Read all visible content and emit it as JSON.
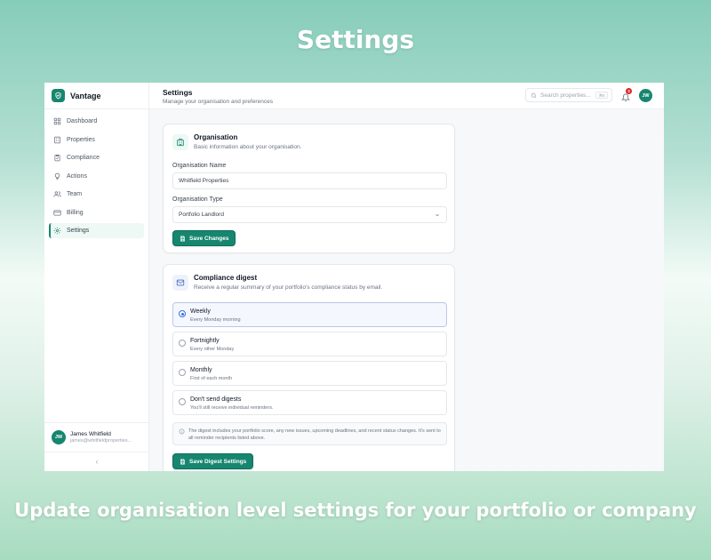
{
  "hero": {
    "title": "Settings",
    "caption": "Update organisation level settings for your portfolio or company"
  },
  "brand": {
    "name": "Vantage",
    "accent": "#16866f"
  },
  "sidebar": {
    "items": [
      {
        "label": "Dashboard",
        "icon": "grid-icon",
        "active": false
      },
      {
        "label": "Properties",
        "icon": "building-icon",
        "active": false
      },
      {
        "label": "Compliance",
        "icon": "clipboard-check-icon",
        "active": false
      },
      {
        "label": "Actions",
        "icon": "lightbulb-icon",
        "active": false
      },
      {
        "label": "Team",
        "icon": "users-icon",
        "active": false
      },
      {
        "label": "Billing",
        "icon": "credit-card-icon",
        "active": false
      },
      {
        "label": "Settings",
        "icon": "gear-icon",
        "active": true
      }
    ],
    "user": {
      "initials": "JW",
      "name": "James Whitfield",
      "email": "james@whitfieldproperties..."
    },
    "collapse_glyph": "‹"
  },
  "header": {
    "title": "Settings",
    "subtitle": "Manage your organisation and preferences",
    "search_placeholder": "Search properties...",
    "search_shortcut": "⌘K",
    "notification_count": "3",
    "avatar_initials": "JW"
  },
  "organisation": {
    "title": "Organisation",
    "description": "Basic information about your organisation.",
    "name_label": "Organisation Name",
    "name_value": "Whitfield Properties",
    "type_label": "Organisation Type",
    "type_value": "Portfolio Landlord",
    "save_label": "Save Changes"
  },
  "digest": {
    "title": "Compliance digest",
    "description": "Receive a regular summary of your portfolio's compliance status by email.",
    "options": [
      {
        "label": "Weekly",
        "desc": "Every Monday morning",
        "selected": true
      },
      {
        "label": "Fortnightly",
        "desc": "Every other Monday",
        "selected": false
      },
      {
        "label": "Monthly",
        "desc": "First of each month",
        "selected": false
      },
      {
        "label": "Don't send digests",
        "desc": "You'll still receive individual reminders.",
        "selected": false
      }
    ],
    "info": "The digest includes your portfolio score, any new issues, upcoming deadlines, and recent status changes. It's sent to all reminder recipients listed above.",
    "save_label": "Save Digest Settings"
  }
}
